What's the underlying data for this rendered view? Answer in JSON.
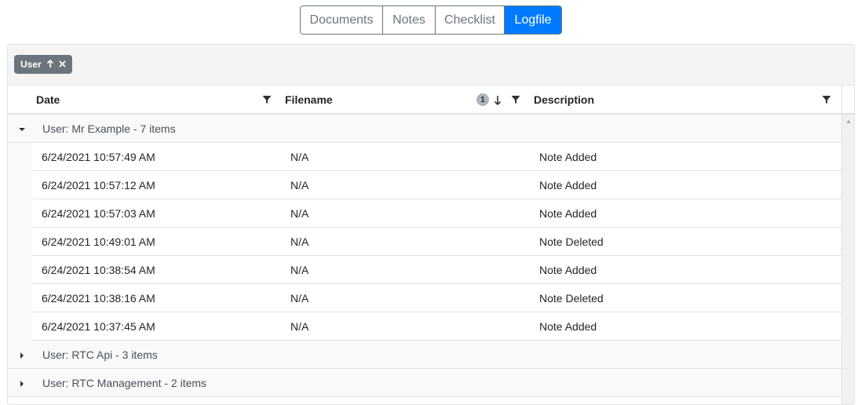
{
  "tabs": [
    {
      "label": "Documents",
      "active": false
    },
    {
      "label": "Notes",
      "active": false
    },
    {
      "label": "Checklist",
      "active": false
    },
    {
      "label": "Logfile",
      "active": true
    }
  ],
  "group_panel": {
    "chip_label": "User",
    "chip_sort_icon": "arrow-up-icon",
    "chip_remove_icon": "close-icon"
  },
  "columns": [
    {
      "label": "Date",
      "filter_icon": "filter-icon"
    },
    {
      "label": "Filename",
      "sort_order": "1",
      "sort_direction": "descending",
      "filter_icon": "filter-icon"
    },
    {
      "label": "Description",
      "filter_icon": "filter-icon"
    }
  ],
  "groups": [
    {
      "label": "User: Mr Example - 7 items",
      "expanded": true,
      "rows": [
        {
          "date": "6/24/2021 10:57:49 AM",
          "filename": "N/A",
          "description": "Note Added"
        },
        {
          "date": "6/24/2021 10:57:12 AM",
          "filename": "N/A",
          "description": "Note Added"
        },
        {
          "date": "6/24/2021 10:57:03 AM",
          "filename": "N/A",
          "description": "Note Added"
        },
        {
          "date": "6/24/2021 10:49:01 AM",
          "filename": "N/A",
          "description": "Note Deleted"
        },
        {
          "date": "6/24/2021 10:38:54 AM",
          "filename": "N/A",
          "description": "Note Added"
        },
        {
          "date": "6/24/2021 10:38:16 AM",
          "filename": "N/A",
          "description": "Note Deleted"
        },
        {
          "date": "6/24/2021 10:37:45 AM",
          "filename": "N/A",
          "description": "Note Added"
        }
      ]
    },
    {
      "label": "User: RTC Api - 3 items",
      "expanded": false,
      "rows": []
    },
    {
      "label": "User: RTC Management - 2 items",
      "expanded": false,
      "rows": []
    }
  ],
  "colors": {
    "accent": "#007bff",
    "chip": "#6c757d",
    "group_bg": "#f8f9fa"
  }
}
